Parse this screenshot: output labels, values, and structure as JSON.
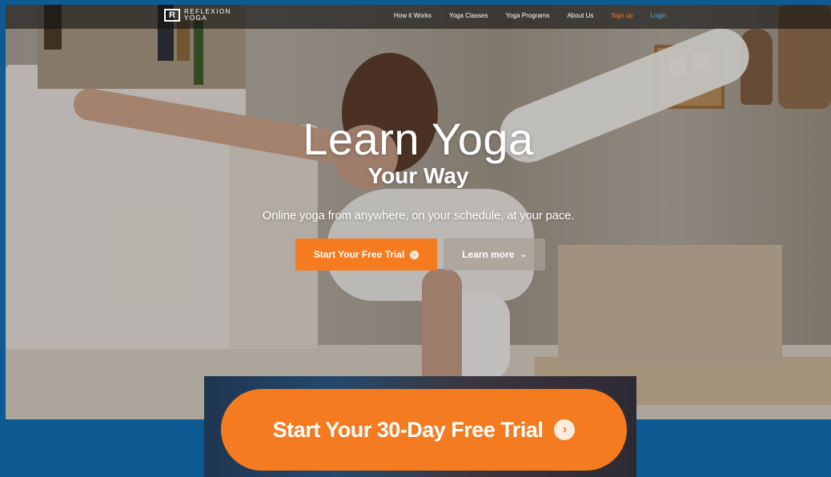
{
  "brand": {
    "mark": "R",
    "line1": "REFLEXION",
    "line2": "YOGA"
  },
  "nav": {
    "items": [
      {
        "label": "How it Works"
      },
      {
        "label": "Yoga Classes"
      },
      {
        "label": "Yoga Programs"
      },
      {
        "label": "About Us"
      },
      {
        "label": "Sign up"
      },
      {
        "label": "Login"
      }
    ]
  },
  "hero": {
    "headline": "Learn Yoga",
    "subheadline": "Your Way",
    "tagline": "Online yoga from anywhere, on your schedule, at your pace.",
    "primary_cta": "Start Your Free Trial",
    "secondary_cta": "Learn more"
  },
  "inset": {
    "cta_label": "Start Your 30-Day Free Trial"
  },
  "icons": {
    "cta_arrow": "circle-arrow-right-icon",
    "learn_more": "chevron-down-icon"
  },
  "colors": {
    "accent_orange": "#f47b20",
    "frame_blue": "#0e5b93",
    "signup": "#f47b20",
    "login": "#4aa8e6"
  }
}
